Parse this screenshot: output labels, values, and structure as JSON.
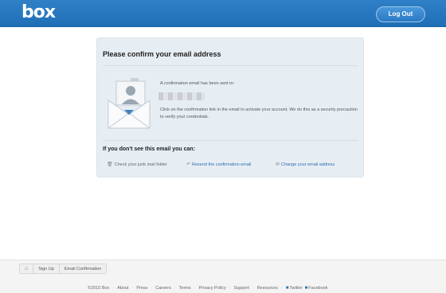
{
  "header": {
    "logo": "box",
    "logout_label": "Log Out"
  },
  "card": {
    "title": "Please confirm your email address",
    "sent_text": "A confirmation email has been sent to:",
    "instructions": "Click on the confirmation link in the email to activate your account. We do this as a security precaution to verify your credentials.",
    "subheading": "If you don't see this email you can:",
    "actions": [
      {
        "label": "Check your junk mail folder",
        "icon": "trash-icon"
      },
      {
        "label": "Resend the confirmation email",
        "icon": "reply-arrow-icon"
      },
      {
        "label": "Change your email address",
        "icon": "mail-icon"
      }
    ]
  },
  "breadcrumb": {
    "items": [
      "Sign Up",
      "Email Confirmation"
    ]
  },
  "footer": {
    "copyright": "©2010 Box",
    "links": [
      "About",
      "Press",
      "Careers",
      "Terms",
      "Privacy Policy",
      "Support",
      "Resources"
    ],
    "social": [
      "Twitter",
      "Facebook"
    ]
  }
}
